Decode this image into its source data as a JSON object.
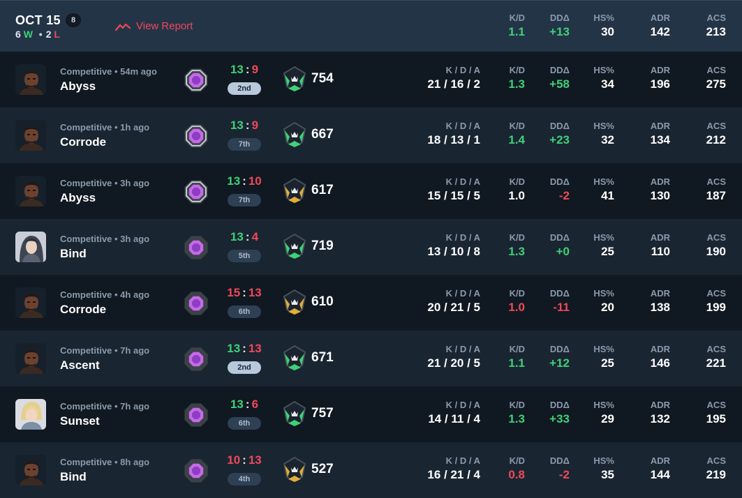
{
  "header": {
    "date": "OCT 15",
    "count": "8",
    "wins": "6",
    "wins_suffix": "W",
    "losses": "2",
    "losses_suffix": "L",
    "dot": "•",
    "view_report": "View Report",
    "stats": [
      {
        "label": "K/D",
        "value": "1.1",
        "color": "green"
      },
      {
        "label": "DDΔ",
        "value": "+13",
        "color": "green"
      },
      {
        "label": "HS%",
        "value": "30",
        "color": "white"
      },
      {
        "label": "ADR",
        "value": "142",
        "color": "white"
      },
      {
        "label": "ACS",
        "value": "213",
        "color": "white"
      }
    ]
  },
  "labels": {
    "kda": "K / D / A",
    "kd": "K/D",
    "dd": "DDΔ",
    "hs": "HS%",
    "adr": "ADR",
    "acs": "ACS"
  },
  "matches": [
    {
      "mode": "Competitive • 54m ago",
      "map": "Abyss",
      "agent": "dark",
      "rank": "silver",
      "score_a": "13",
      "score_b": "9",
      "win": true,
      "place": "2nd",
      "place_hl": true,
      "perf": "754",
      "perf_color": "green",
      "kda": "21 / 16 / 2",
      "kd": "1.3",
      "kd_color": "green",
      "dd": "+58",
      "dd_color": "green",
      "hs": "34",
      "adr": "196",
      "acs": "275"
    },
    {
      "mode": "Competitive • 1h ago",
      "map": "Corrode",
      "agent": "dark",
      "rank": "silver",
      "score_a": "13",
      "score_b": "9",
      "win": true,
      "place": "7th",
      "place_hl": false,
      "perf": "667",
      "perf_color": "green",
      "kda": "18 / 13 / 1",
      "kd": "1.4",
      "kd_color": "green",
      "dd": "+23",
      "dd_color": "green",
      "hs": "32",
      "adr": "134",
      "acs": "212"
    },
    {
      "mode": "Competitive • 3h ago",
      "map": "Abyss",
      "agent": "dark",
      "rank": "silver",
      "score_a": "13",
      "score_b": "10",
      "win": true,
      "place": "7th",
      "place_hl": false,
      "perf": "617",
      "perf_color": "gold",
      "kda": "15 / 15 / 5",
      "kd": "1.0",
      "kd_color": "white",
      "dd": "-2",
      "dd_color": "red",
      "hs": "41",
      "adr": "130",
      "acs": "187"
    },
    {
      "mode": "Competitive • 3h ago",
      "map": "Bind",
      "agent": "female",
      "rank": "plain",
      "score_a": "13",
      "score_b": "4",
      "win": true,
      "place": "5th",
      "place_hl": false,
      "perf": "719",
      "perf_color": "green",
      "kda": "13 / 10 / 8",
      "kd": "1.3",
      "kd_color": "green",
      "dd": "+0",
      "dd_color": "green",
      "hs": "25",
      "adr": "110",
      "acs": "190"
    },
    {
      "mode": "Competitive • 4h ago",
      "map": "Corrode",
      "agent": "dark",
      "rank": "plain",
      "score_a": "15",
      "score_b": "13",
      "win": false,
      "place": "6th",
      "place_hl": false,
      "perf": "610",
      "perf_color": "gold",
      "kda": "20 / 21 / 5",
      "kd": "1.0",
      "kd_color": "red",
      "dd": "-11",
      "dd_color": "red",
      "hs": "20",
      "adr": "138",
      "acs": "199"
    },
    {
      "mode": "Competitive • 7h ago",
      "map": "Ascent",
      "agent": "dark",
      "rank": "plain",
      "score_a": "13",
      "score_b": "13",
      "win": false,
      "place": "2nd",
      "place_hl": true,
      "perf": "671",
      "perf_color": "green",
      "kda": "21 / 20 / 5",
      "kd": "1.1",
      "kd_color": "green",
      "dd": "+12",
      "dd_color": "green",
      "hs": "25",
      "adr": "146",
      "acs": "221"
    },
    {
      "mode": "Competitive • 7h ago",
      "map": "Sunset",
      "agent": "blond",
      "rank": "plain",
      "score_a": "13",
      "score_b": "6",
      "win": true,
      "place": "6th",
      "place_hl": false,
      "perf": "757",
      "perf_color": "green",
      "kda": "14 / 11 / 4",
      "kd": "1.3",
      "kd_color": "green",
      "dd": "+33",
      "dd_color": "green",
      "hs": "29",
      "adr": "132",
      "acs": "195"
    },
    {
      "mode": "Competitive • 8h ago",
      "map": "Bind",
      "agent": "dark",
      "rank": "plain",
      "score_a": "10",
      "score_b": "13",
      "win": false,
      "place": "4th",
      "place_hl": false,
      "perf": "527",
      "perf_color": "gold",
      "kda": "16 / 21 / 4",
      "kd": "0.8",
      "kd_color": "red",
      "dd": "-2",
      "dd_color": "red",
      "hs": "35",
      "adr": "144",
      "acs": "219"
    }
  ]
}
